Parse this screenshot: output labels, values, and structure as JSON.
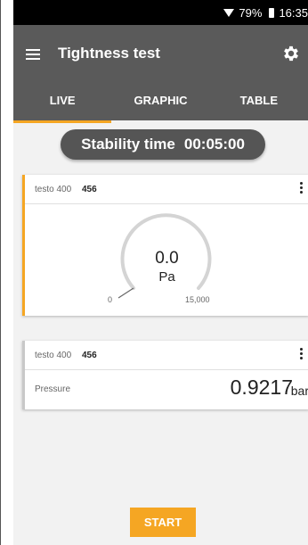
{
  "status_bar": {
    "battery_percent": "79%",
    "time": "16:35"
  },
  "app_bar": {
    "title": "Tightness test",
    "menu_icon": "menu-icon",
    "settings_icon": "gear-icon"
  },
  "tabs": [
    {
      "label": "LIVE",
      "active": true
    },
    {
      "label": "GRAPHIC",
      "active": false
    },
    {
      "label": "TABLE",
      "active": false
    }
  ],
  "stability": {
    "label": "Stability time",
    "time": "00:05:00"
  },
  "gauge_card": {
    "device_name": "testo 400",
    "device_id": "456",
    "value": "0.0",
    "unit": "Pa",
    "range_min": "0",
    "range_max": "15,000"
  },
  "pressure_card": {
    "device_name": "testo 400",
    "device_id": "456",
    "label": "Pressure",
    "value": "0.9217",
    "unit": "bar"
  },
  "start_button": {
    "label": "START"
  },
  "colors": {
    "accent": "#f5a623",
    "app_bar": "#5a5a5a",
    "background": "#f2f2f2"
  }
}
